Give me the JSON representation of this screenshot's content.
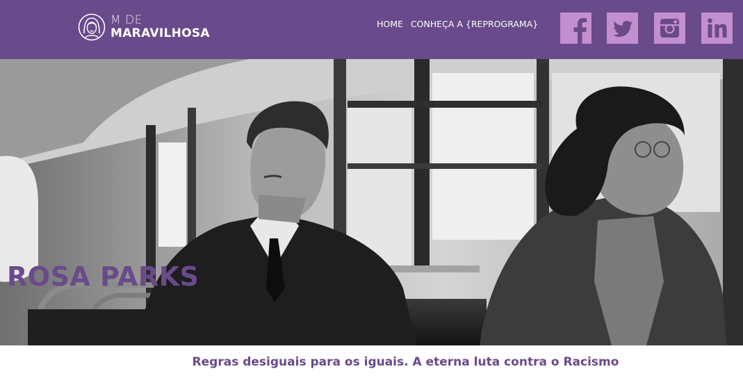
{
  "header": {
    "logo": {
      "line1": "M DE",
      "line2": "MARAVILHOSA",
      "icon": "woman-portrait-logo-icon"
    },
    "nav": [
      {
        "label": "HOME"
      },
      {
        "label": "CONHEÇA A {REPROGRAMA}"
      }
    ],
    "social": [
      {
        "name": "facebook-icon"
      },
      {
        "name": "twitter-icon"
      },
      {
        "name": "instagram-icon"
      },
      {
        "name": "linkedin-icon"
      }
    ]
  },
  "hero": {
    "title": "ROSA PARKS",
    "image": "black-and-white-photo-bus-passengers"
  },
  "subtitle": "Regras desiguais para os iguais. A eterna luta contra o Racismo",
  "colors": {
    "brand_purple": "#694a8a",
    "social_tile": "#c38fce",
    "text_white": "#ffffff"
  }
}
